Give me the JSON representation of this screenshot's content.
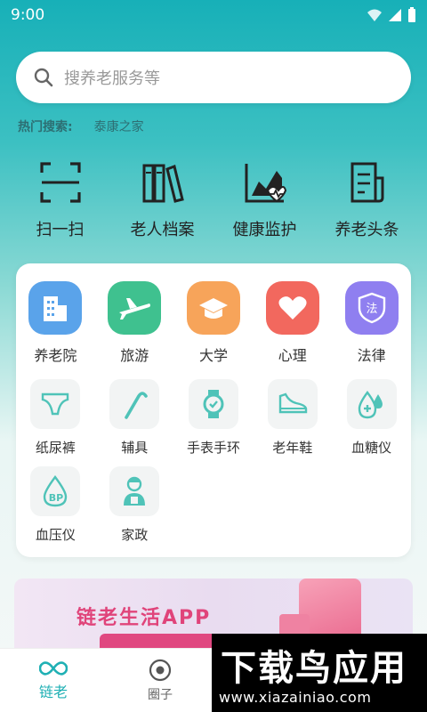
{
  "status": {
    "time": "9:00"
  },
  "search": {
    "placeholder": "搜养老服务等"
  },
  "hot": {
    "label": "热门搜索:",
    "keyword": "泰康之家"
  },
  "quick_actions": [
    {
      "label": "扫一扫",
      "icon": "scan-icon"
    },
    {
      "label": "老人档案",
      "icon": "archive-books-icon"
    },
    {
      "label": "健康监护",
      "icon": "health-chart-icon"
    },
    {
      "label": "养老头条",
      "icon": "news-document-icon"
    }
  ],
  "services": [
    {
      "label": "养老院",
      "icon": "building-icon",
      "color": "#5aa3ea"
    },
    {
      "label": "旅游",
      "icon": "airplane-icon",
      "color": "#3fc18f"
    },
    {
      "label": "大学",
      "icon": "graduation-cap-icon",
      "color": "#f7a45a"
    },
    {
      "label": "心理",
      "icon": "heart-icon",
      "color": "#f2685e"
    },
    {
      "label": "法律",
      "icon": "law-shield-icon",
      "color": "#8f7ff0"
    }
  ],
  "products": [
    {
      "label": "纸尿裤",
      "icon": "diaper-icon"
    },
    {
      "label": "辅具",
      "icon": "cane-icon"
    },
    {
      "label": "手表手环",
      "icon": "watch-icon"
    },
    {
      "label": "老年鞋",
      "icon": "shoe-icon"
    },
    {
      "label": "血糖仪",
      "icon": "blood-glucose-icon"
    },
    {
      "label": "血压仪",
      "icon": "blood-pressure-icon"
    },
    {
      "label": "家政",
      "icon": "housekeeper-icon"
    }
  ],
  "banner": {
    "title": "链老生活APP"
  },
  "tabs": [
    {
      "label": "链老",
      "icon": "infinity-icon",
      "active": true
    },
    {
      "label": "圈子",
      "icon": "circle-target-icon",
      "active": false
    }
  ],
  "watermark": {
    "title": "下载鸟应用",
    "url": "www.xiazainiao.com"
  },
  "colors": {
    "accent": "#1fb0b4",
    "icon_teal": "#4fc3b8"
  }
}
